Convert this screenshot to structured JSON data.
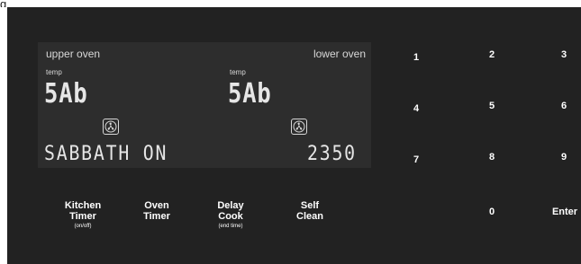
{
  "page_fragment_text": "g",
  "display": {
    "upper_label": "upper oven",
    "lower_label": "lower oven",
    "upper_temp_label": "temp",
    "lower_temp_label": "temp",
    "upper_temp_value": "5Ab",
    "lower_temp_value": "5Ab",
    "status_text": "SABBATH ON",
    "clock_value": "2350",
    "upper_fan_icon": "convection-fan-icon",
    "lower_fan_icon": "convection-fan-icon"
  },
  "keypad": {
    "k1": "1",
    "k2": "2",
    "k3": "3",
    "k4": "4",
    "k5": "5",
    "k6": "6",
    "k7": "7",
    "k8": "8",
    "k9": "9",
    "k0": "0",
    "enter": "Enter"
  },
  "function_keys": {
    "kitchen_timer": {
      "line1": "Kitchen",
      "line2": "Timer",
      "sub": "(on/off)"
    },
    "oven_timer": {
      "line1": "Oven",
      "line2": "Timer"
    },
    "delay_cook": {
      "line1": "Delay",
      "line2": "Cook",
      "sub": "(end time)"
    },
    "self_clean": {
      "line1": "Self",
      "line2": "Clean"
    }
  },
  "colors": {
    "panel": "#222222",
    "display": "#2d2d2d",
    "segment": "#e6e6e6",
    "label": "#d8d8d8"
  }
}
